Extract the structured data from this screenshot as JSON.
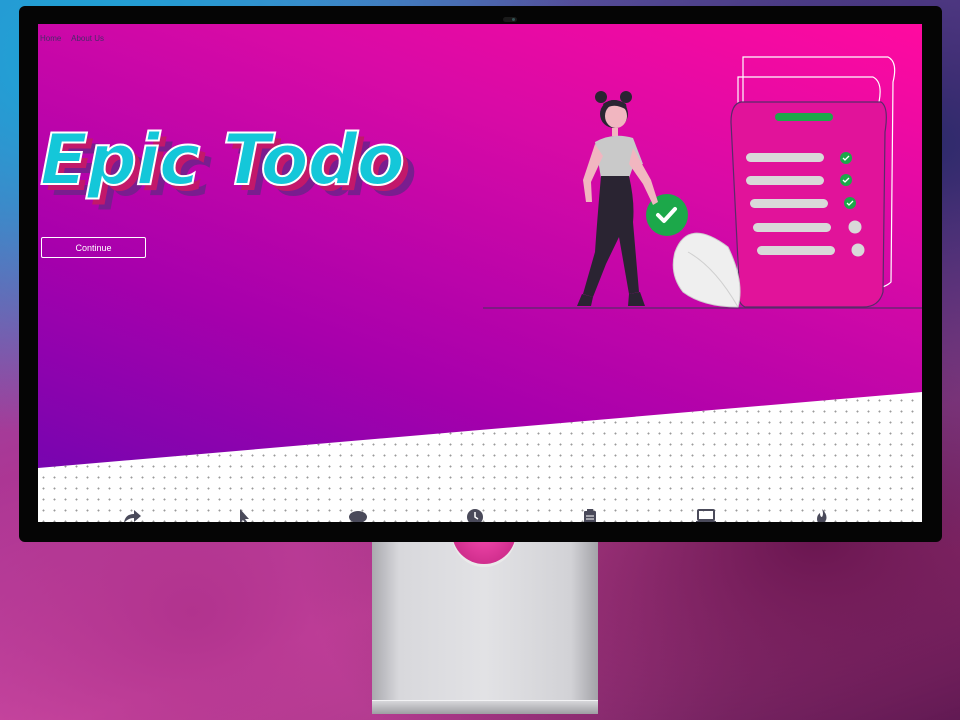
{
  "nav": {
    "items": [
      "Home",
      "About Us"
    ]
  },
  "hero": {
    "title": "Epic Todo",
    "continue_label": "Continue"
  },
  "feature_icons": [
    "share-icon",
    "cursor-icon",
    "chat-icon",
    "clock-icon",
    "clipboard-icon",
    "laptop-icon",
    "fire-icon"
  ],
  "colors": {
    "hero_start": "#ff0aa0",
    "hero_end": "#6c06b0",
    "title_fill": "#14c7d9",
    "check_green": "#1ca84a"
  }
}
